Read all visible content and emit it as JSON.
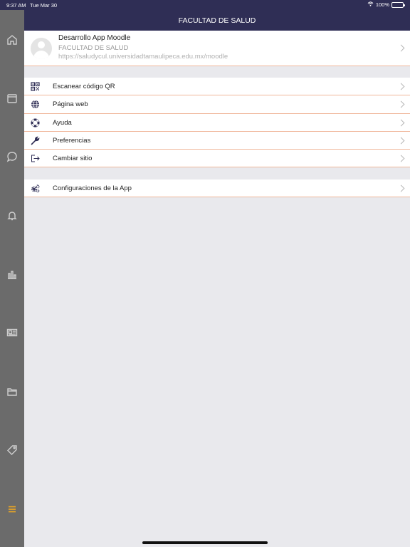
{
  "status_bar": {
    "time": "9:37 AM",
    "date": "Tue Mar 30",
    "battery": "100%"
  },
  "header": {
    "title": "FACULTAD DE SALUD"
  },
  "profile": {
    "name": "Desarrollo App Moodle",
    "site_name": "FACULTAD DE SALUD",
    "url": "https://saludycul.universidadtamaulipeca.edu.mx/moodle"
  },
  "menu": [
    {
      "label": "Escanear código QR",
      "icon": "qr-code-icon"
    },
    {
      "label": "Página web",
      "icon": "globe-icon"
    },
    {
      "label": "Ayuda",
      "icon": "lifebuoy-icon"
    },
    {
      "label": "Preferencias",
      "icon": "wrench-icon"
    },
    {
      "label": "Cambiar sitio",
      "icon": "sign-out-icon"
    }
  ],
  "app_settings": {
    "label": "Configuraciones de la App",
    "icon": "gears-icon"
  },
  "sidebar_icons": [
    "home-icon",
    "calendar-icon",
    "chat-icon",
    "bell-icon",
    "grades-icon",
    "news-icon",
    "folder-icon",
    "tag-icon",
    "menu-icon"
  ],
  "colors": {
    "header": "#2f2e55",
    "sidebar": "#6b6b6b",
    "divider": "#f0b79b",
    "active_sidebar": "#f0a820"
  }
}
